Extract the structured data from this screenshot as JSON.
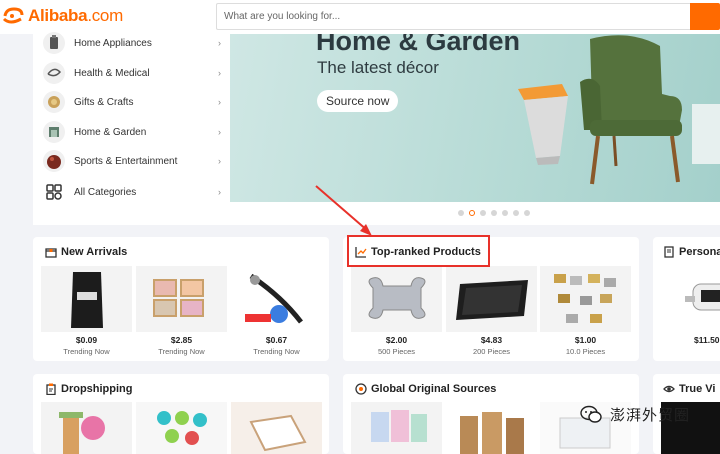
{
  "header": {
    "logo_text": "Alibaba",
    "logo_suffix": ".com",
    "search_placeholder": "What are you looking for..."
  },
  "categories": [
    {
      "label": "Home Appliances",
      "icon": "appliance-icon"
    },
    {
      "label": "Health & Medical",
      "icon": "health-icon"
    },
    {
      "label": "Gifts & Crafts",
      "icon": "gift-icon"
    },
    {
      "label": "Home & Garden",
      "icon": "home-icon"
    },
    {
      "label": "Sports & Entertainment",
      "icon": "sports-icon"
    },
    {
      "label": "All Categories",
      "icon": "grid-icon"
    }
  ],
  "banner": {
    "title": "Home & Garden",
    "subtitle": "The latest décor",
    "button": "Source now",
    "slides": 7,
    "active_slide": 2
  },
  "cards": {
    "new_arrivals": {
      "title": "New Arrivals",
      "items": [
        {
          "price": "$0.09",
          "sub": "Trending Now"
        },
        {
          "price": "$2.85",
          "sub": "Trending Now"
        },
        {
          "price": "$0.67",
          "sub": "Trending Now"
        }
      ]
    },
    "top_ranked": {
      "title": "Top-ranked Products",
      "items": [
        {
          "price": "$2.00",
          "sub": "500 Pieces"
        },
        {
          "price": "$4.83",
          "sub": "200 Pieces"
        },
        {
          "price": "$1.00",
          "sub": "10.0 Pieces"
        }
      ]
    },
    "personal": {
      "title": "Personal",
      "items": [
        {
          "price": "$11.50",
          "sub": ""
        }
      ]
    },
    "dropshipping": {
      "title": "Dropshipping"
    },
    "global_sources": {
      "title": "Global Original Sources"
    },
    "true_view": {
      "title": "True Vi"
    }
  },
  "watermark": "澎湃外贸圈",
  "colors": {
    "accent": "#ff6a00",
    "annotation": "#e8312a"
  }
}
